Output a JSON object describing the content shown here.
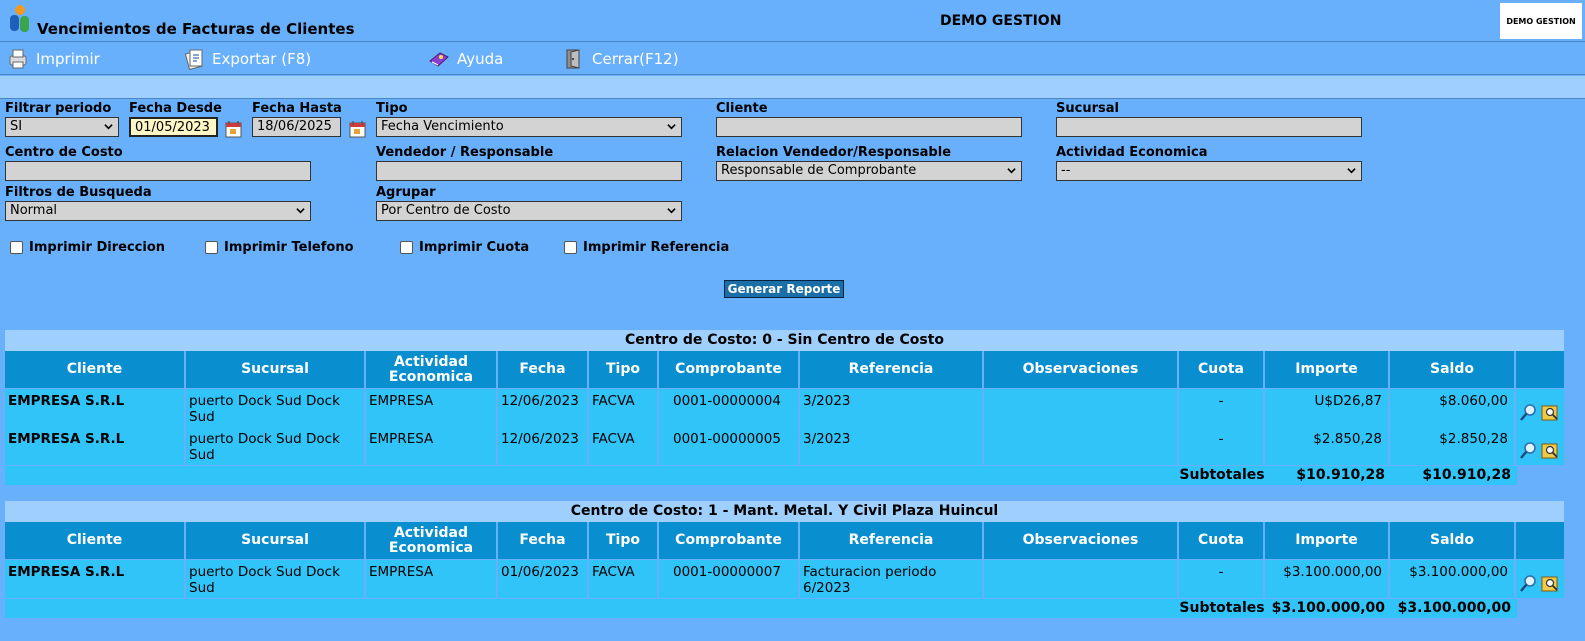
{
  "window": {
    "title": "Vencimientos de Facturas de Clientes",
    "company": "DEMO GESTION",
    "corner_logo": "DEMO GESTION"
  },
  "toolbar": {
    "print": "Imprimir",
    "export": "Exportar (F8)",
    "help": "Ayuda",
    "close": "Cerrar(F12)"
  },
  "filters": {
    "periodo": {
      "label": "Filtrar periodo",
      "value": "SI"
    },
    "fecha_desde": {
      "label": "Fecha Desde",
      "value": "01/05/2023"
    },
    "fecha_hasta": {
      "label": "Fecha Hasta",
      "value": "18/06/2025"
    },
    "tipo": {
      "label": "Tipo",
      "value": "Fecha Vencimiento"
    },
    "cliente": {
      "label": "Cliente",
      "value": ""
    },
    "sucursal": {
      "label": "Sucursal",
      "value": ""
    },
    "centro_costo": {
      "label": "Centro de Costo",
      "value": ""
    },
    "vendedor": {
      "label": "Vendedor / Responsable",
      "value": ""
    },
    "relacion": {
      "label": "Relacion Vendedor/Responsable",
      "value": "Responsable de Comprobante"
    },
    "actividad": {
      "label": "Actividad Economica",
      "value": "--"
    },
    "busqueda": {
      "label": "Filtros de Busqueda",
      "value": "Normal"
    },
    "agrupar": {
      "label": "Agrupar",
      "value": "Por Centro de Costo"
    }
  },
  "checkboxes": {
    "direccion": "Imprimir Direccion",
    "telefono": "Imprimir Telefono",
    "cuota": "Imprimir Cuota",
    "referencia": "Imprimir Referencia"
  },
  "generate_label": "Generar Reporte",
  "columns": {
    "cliente": "Cliente",
    "sucursal": "Sucursal",
    "actividad_1": "Actividad",
    "actividad_2": "Economica",
    "fecha": "Fecha",
    "tipo": "Tipo",
    "comprobante": "Comprobante",
    "referencia": "Referencia",
    "observaciones": "Observaciones",
    "cuota": "Cuota",
    "importe": "Importe",
    "saldo": "Saldo"
  },
  "subtotal_label": "Subtotales",
  "groups": [
    {
      "title": "Centro de Costo: 0 - Sin Centro de Costo",
      "rows": [
        {
          "cliente": "EMPRESA S.R.L",
          "sucursal": "puerto Dock Sud Dock Sud",
          "actividad": "EMPRESA",
          "fecha": "12/06/2023",
          "tipo": "FACVA",
          "comprobante": "0001-00000004",
          "referencia": "3/2023",
          "observaciones": "",
          "cuota": "-",
          "importe": "U$D26,87",
          "saldo": "$8.060,00"
        },
        {
          "cliente": "EMPRESA S.R.L",
          "sucursal": "puerto Dock Sud Dock Sud",
          "actividad": "EMPRESA",
          "fecha": "12/06/2023",
          "tipo": "FACVA",
          "comprobante": "0001-00000005",
          "referencia": "3/2023",
          "observaciones": "",
          "cuota": "-",
          "importe": "$2.850,28",
          "saldo": "$2.850,28"
        }
      ],
      "subtotal_importe": "$10.910,28",
      "subtotal_saldo": "$10.910,28"
    },
    {
      "title": "Centro de Costo: 1 - Mant. Metal. Y Civil Plaza Huincul",
      "rows": [
        {
          "cliente": "EMPRESA S.R.L",
          "sucursal": "puerto Dock Sud Dock Sud",
          "actividad": "EMPRESA",
          "fecha": "01/06/2023",
          "tipo": "FACVA",
          "comprobante": "0001-00000007",
          "referencia": "Facturacion periodo 6/2023",
          "observaciones": "",
          "cuota": "-",
          "importe": "$3.100.000,00",
          "saldo": "$3.100.000,00"
        }
      ],
      "subtotal_importe": "$3.100.000,00",
      "subtotal_saldo": "$3.100.000,00"
    }
  ]
}
